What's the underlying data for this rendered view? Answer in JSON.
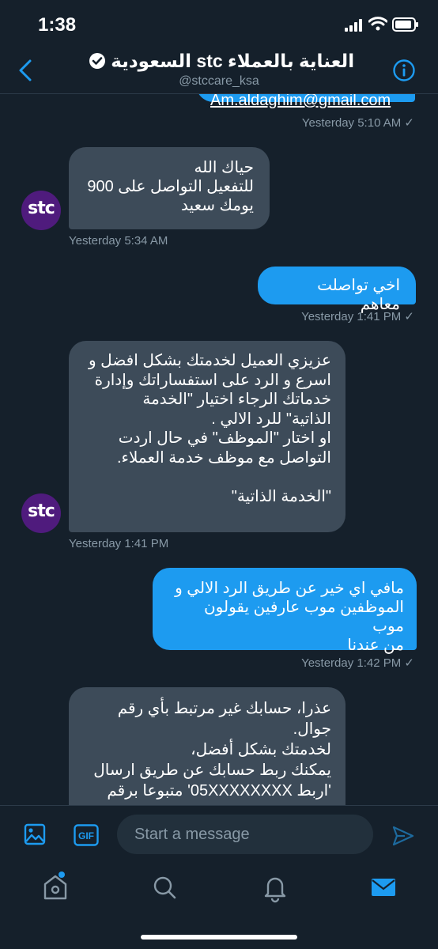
{
  "status_bar": {
    "time": "1:38"
  },
  "header": {
    "title": "العناية بالعملاء stc السعودية",
    "handle": "@stccare_ksa"
  },
  "avatar": {
    "text": "stc",
    "color": "#4f1b7d"
  },
  "messages": [
    {
      "dir": "out",
      "text": "Am.aldaghim@gmail.com",
      "time": "Yesterday 5:10 AM ✓"
    },
    {
      "dir": "in",
      "text": "حياك الله\nللتفعيل التواصل على 900\nيومك سعيد",
      "time": "Yesterday 5:34 AM"
    },
    {
      "dir": "out",
      "text": "اخي تواصلت معاهم",
      "time": "Yesterday 1:41 PM ✓"
    },
    {
      "dir": "in",
      "text": "عزيزي العميل لخدمتك بشكل افضل و\nاسرع و الرد على استفساراتك وإدارة\nخدماتك الرجاء اختيار \"الخدمة\nالذاتية\" للرد الالي .\nاو اختار \"الموظف\" في حال اردت\nالتواصل مع موظف خدمة العملاء.\n\n\"الخدمة الذاتية\"",
      "time": "Yesterday 1:41 PM"
    },
    {
      "dir": "out",
      "text": "مافي اي خير عن طريق الرد الالي و\nالموظفين موب عارفين يقولون موب\nمن عندنا",
      "time": "Yesterday 1:42 PM ✓"
    },
    {
      "dir": "in",
      "text": "عذرا، حسابك غير مرتبط بأي رقم\nجوال.\nلخدمتك بشكل أفضل،\nيمكنك ربط حسابك عن طريق ارسال\n'اربط 05XXXXXXXX' متبوعا برقم",
      "time": ""
    }
  ],
  "composer": {
    "placeholder": "Start a message",
    "gif_label": "GIF"
  },
  "colors": {
    "background": "#15202b",
    "accent": "#1d9bf0",
    "incoming": "#3d4b59",
    "muted": "#8899a6"
  }
}
